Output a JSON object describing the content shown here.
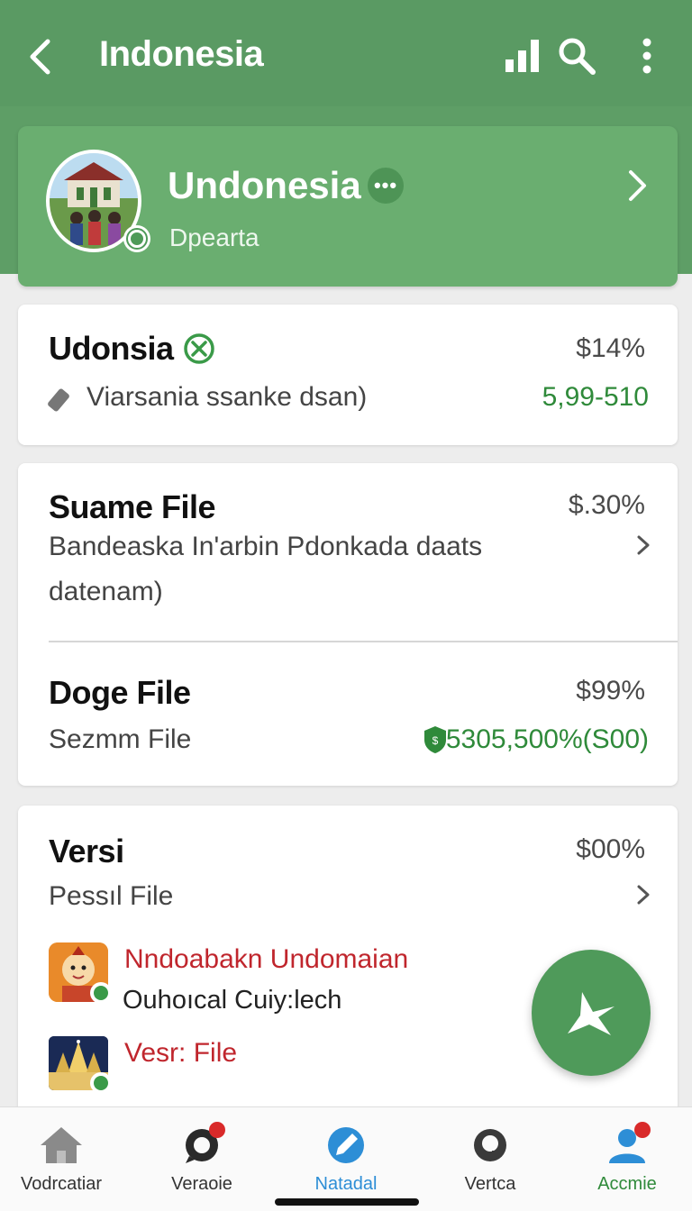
{
  "colors": {
    "appbar": "#5a9a63",
    "hero_card": "#6aae70",
    "accent_green": "#2f8a3a",
    "accent_red": "#c0262d",
    "nav_active": "#2d8ed6"
  },
  "appbar": {
    "title": "Indonesia",
    "icons": [
      "back-arrow-icon",
      "bar-chart-icon",
      "search-icon",
      "more-vert-icon"
    ]
  },
  "hero": {
    "title": "Undonesia",
    "badge": "•••",
    "subtitle": "Dpearta"
  },
  "card1": {
    "title": "Udonsia",
    "percent": "$14%",
    "subtitle": "Viarsania ssanke dsan)",
    "value": "5,99-510"
  },
  "card2": {
    "row1": {
      "title": "Suame File",
      "percent": "$.30%",
      "subtitle_line1": "Bandeaska In'arbin Pdonkada daats",
      "subtitle_line2": "datenam)"
    },
    "row2": {
      "title": "Doge File",
      "percent": "$99%",
      "subtitle": "Sezmm File",
      "value": "5305,500%(S00)"
    }
  },
  "card3": {
    "title": "Versi",
    "percent": "$00%",
    "subtitle": "Pessıl File",
    "items": [
      {
        "title": "Nndoabakn Undomaian",
        "subtitle": "Ouhoıcal Cuiy:lech"
      },
      {
        "title": "Vesr: File",
        "subtitle": ""
      }
    ]
  },
  "bottom_nav": [
    {
      "label": "Vodrcatiar",
      "icon": "home-icon",
      "active": false,
      "badge": false
    },
    {
      "label": "Veraoie",
      "icon": "chat-icon",
      "active": false,
      "badge": true
    },
    {
      "label": "Natadal",
      "icon": "edit-icon",
      "active": true,
      "badge": false
    },
    {
      "label": "Vertca",
      "icon": "search-circle-icon",
      "active": false,
      "badge": false
    },
    {
      "label": "Accmie",
      "icon": "profile-icon",
      "active": false,
      "badge": true
    }
  ]
}
